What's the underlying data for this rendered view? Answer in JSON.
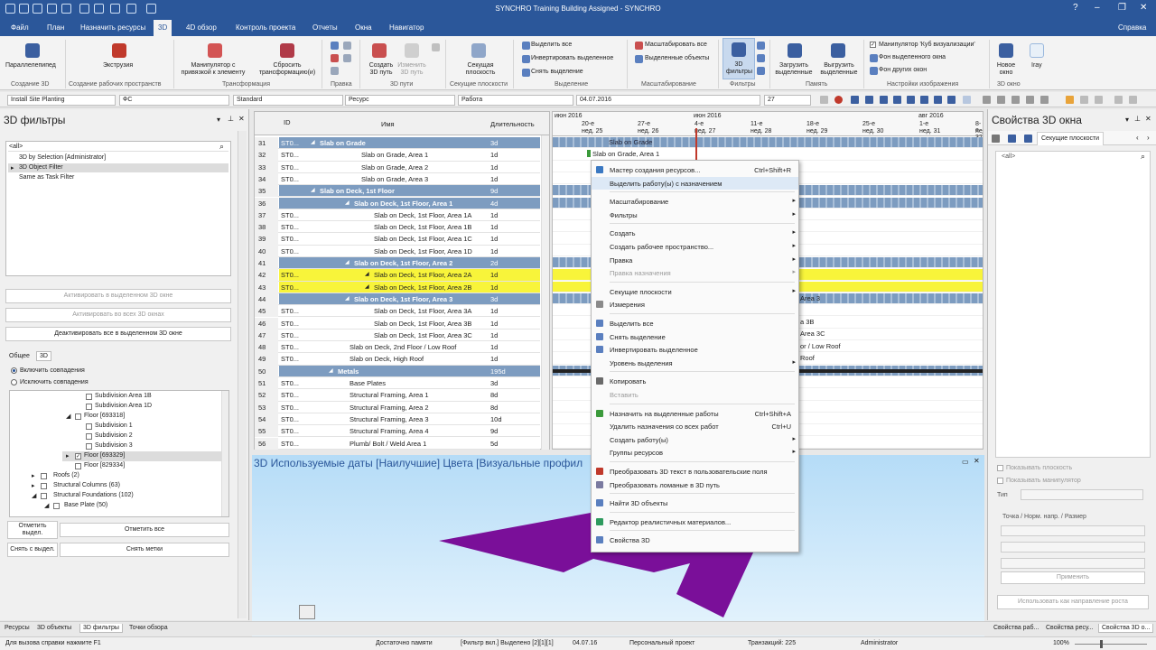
{
  "title": "SYNCHRO Training Building Assigned - SYNCHRO",
  "menu_tabs": [
    "Файл",
    "План",
    "Назначить ресурсы",
    "3D",
    "4D обзор",
    "Контроль проекта",
    "Отчеты",
    "Окна",
    "Навигатор"
  ],
  "help_label": "Справка",
  "ribbon": {
    "parallel": "Параллелепипед",
    "create3d": "Создание 3D",
    "extrude": "Экструзия",
    "create_ws": "Создание рабочих пространств",
    "manip": "Манипулятор с привязкой к элементу",
    "reset_tr": "Сбросить трансформацию(и)",
    "transform": "Трансформация",
    "edit": "Правка",
    "create3d_path": "Создать 3D путь",
    "change3d_path": "Изменить 3D путь",
    "paths3d": "3D пути",
    "section_plane": "Секущая плоскость",
    "section_planes": "Секущие плоскости",
    "sel_all": "Выделить все",
    "invert_sel": "Инвертировать выделенное",
    "clear_sel": "Снять выделение",
    "selection": "Выделение",
    "zoom_all": "Масштабировать все",
    "zoom_sel": "Выделенные объекты",
    "zoom": "Масштабирование",
    "filters3d": "3D фильтры",
    "filters": "Фильтры",
    "load_sel": "Загрузить выделенные",
    "unload_sel": "Выгрузить выделенные",
    "memory": "Память",
    "manip_cube": "Манипулятор 'Куб визуализации'",
    "bg_sel": "Фон выделенного окна",
    "bg_other": "Фон других окон",
    "image_settings": "Настройки изображения",
    "new_window": "Новое окно",
    "iray": "Iray",
    "window3d": "3D окно"
  },
  "filterbar": {
    "f1": "Install Site Planting",
    "f2": "ФС",
    "f3": "Standard",
    "f4": "Ресурс",
    "f5": "Работа",
    "date": "04.07.2016",
    "num": "27"
  },
  "left": {
    "title": "3D фильтры",
    "search_ph": "<all>",
    "items": [
      "3D by Selection [Administrator]",
      "3D Object Filter",
      "Same as Task Filter"
    ],
    "btn_act_sel": "Активировать в выделенном 3D окне",
    "btn_act_all": "Активировать во всех 3D окнах",
    "btn_deact": "Деактивировать все в выделенном 3D окне",
    "tab_common": "Общее",
    "tab_3d": "3D",
    "include": "Включить совпадения",
    "exclude": "Исключить совпадения",
    "tree": [
      "Subdivision Area 1B",
      "Subdivision Area 1D",
      "Floor [693318]",
      "Subdivision 1",
      "Subdivision 2",
      "Subdivision 3",
      "Floor [693329]",
      "Floor [829334]",
      "Roofs (2)",
      "Structural Columns (63)",
      "Structural Foundations (102)",
      "Base Plate (50)"
    ],
    "mark_sel": "Отметить выдел.",
    "mark_all": "Отметить все",
    "unmark_sel": "Снять с выдел.",
    "clear_marks": "Снять метки"
  },
  "grid": {
    "col_id": "ID",
    "col_name": "Имя",
    "col_dur": "Длительность",
    "rows": [
      {
        "n": "31",
        "id": "ST0...",
        "name": "Slab on Grade",
        "dur": "3d",
        "kind": "sum"
      },
      {
        "n": "32",
        "id": "ST0...",
        "name": "Slab on Grade, Area 1",
        "dur": "1d",
        "kind": "task"
      },
      {
        "n": "33",
        "id": "ST0...",
        "name": "Slab on Grade, Area 2",
        "dur": "1d",
        "kind": "task"
      },
      {
        "n": "34",
        "id": "ST0...",
        "name": "Slab on Grade, Area 3",
        "dur": "1d",
        "kind": "task"
      },
      {
        "n": "35",
        "id": "",
        "name": "Slab on Deck, 1st Floor",
        "dur": "9d",
        "kind": "sum"
      },
      {
        "n": "36",
        "id": "",
        "name": "Slab on Deck, 1st Floor, Area 1",
        "dur": "4d",
        "kind": "sum2"
      },
      {
        "n": "37",
        "id": "ST0...",
        "name": "Slab on Deck, 1st Floor, Area 1A",
        "dur": "1d",
        "kind": "task"
      },
      {
        "n": "38",
        "id": "ST0...",
        "name": "Slab on Deck, 1st Floor, Area 1B",
        "dur": "1d",
        "kind": "task"
      },
      {
        "n": "39",
        "id": "ST0...",
        "name": "Slab on Deck, 1st Floor, Area 1C",
        "dur": "1d",
        "kind": "task"
      },
      {
        "n": "40",
        "id": "ST0...",
        "name": "Slab on Deck, 1st Floor, Area 1D",
        "dur": "1d",
        "kind": "task"
      },
      {
        "n": "41",
        "id": "",
        "name": "Slab on Deck, 1st Floor, Area 2",
        "dur": "2d",
        "kind": "sum2"
      },
      {
        "n": "42",
        "id": "ST0...",
        "name": "Slab on Deck, 1st Floor, Area 2A",
        "dur": "1d",
        "kind": "yel"
      },
      {
        "n": "43",
        "id": "ST0...",
        "name": "Slab on Deck, 1st Floor, Area 2B",
        "dur": "1d",
        "kind": "yel"
      },
      {
        "n": "44",
        "id": "",
        "name": "Slab on Deck, 1st Floor, Area 3",
        "dur": "3d",
        "kind": "sum2"
      },
      {
        "n": "45",
        "id": "ST0...",
        "name": "Slab on Deck, 1st Floor, Area 3A",
        "dur": "1d",
        "kind": "task"
      },
      {
        "n": "46",
        "id": "ST0...",
        "name": "Slab on Deck, 1st Floor, Area 3B",
        "dur": "1d",
        "kind": "task"
      },
      {
        "n": "47",
        "id": "ST0...",
        "name": "Slab on Deck, 1st Floor, Area 3C",
        "dur": "1d",
        "kind": "task"
      },
      {
        "n": "48",
        "id": "ST0...",
        "name": "Slab on Deck, 2nd Floor / Low Roof",
        "dur": "1d",
        "kind": "task"
      },
      {
        "n": "49",
        "id": "ST0...",
        "name": "Slab on Deck, High Roof",
        "dur": "1d",
        "kind": "task"
      },
      {
        "n": "50",
        "id": "",
        "name": "Metals",
        "dur": "195d",
        "kind": "sum"
      },
      {
        "n": "51",
        "id": "ST0...",
        "name": "Base Plates",
        "dur": "3d",
        "kind": "task"
      },
      {
        "n": "52",
        "id": "ST0...",
        "name": "Structural Framing, Area 1",
        "dur": "8d",
        "kind": "task"
      },
      {
        "n": "53",
        "id": "ST0...",
        "name": "Structural Framing, Area 2",
        "dur": "8d",
        "kind": "task"
      },
      {
        "n": "54",
        "id": "ST0...",
        "name": "Structural Framing, Area 3",
        "dur": "10d",
        "kind": "task"
      },
      {
        "n": "55",
        "id": "ST0...",
        "name": "Structural Framing, Area 4",
        "dur": "9d",
        "kind": "task"
      },
      {
        "n": "56",
        "id": "ST0...",
        "name": "Plumb/ Bolt / Weld Area 1",
        "dur": "5d",
        "kind": "task"
      }
    ]
  },
  "gantt": {
    "months": [
      "июн 2016",
      "июн 2016",
      "авг 2016"
    ],
    "days": [
      "20-е",
      "27-е",
      "4-е",
      "11-е",
      "18-е",
      "25-е",
      "1-е",
      "8-е"
    ],
    "weeks": [
      "нед. 25",
      "нед. 26",
      "нед. 27",
      "нед. 28",
      "нед. 29",
      "нед. 30",
      "нед. 31",
      "нед. 32"
    ],
    "labels": [
      "Slab on Grade",
      "Slab on Grade, Area 1",
      "Area 3",
      "a 3B",
      "Area 3C",
      "or / Low Roof",
      "Roof"
    ]
  },
  "viewer": {
    "title": "3D Используемые даты [Наилучшие] Цвета [Визуальные профил"
  },
  "context_menu": [
    {
      "t": "Мастер создания ресурсов...",
      "k": "Ctrl+Shift+R",
      "ico": "#3a78c2"
    },
    {
      "t": "Выделить работу(ы) с назначением",
      "hl": true
    },
    {
      "sep": true
    },
    {
      "t": "Масштабирование",
      "sub": true
    },
    {
      "t": "Фильтры",
      "sub": true
    },
    {
      "sep": true
    },
    {
      "t": "Создать",
      "sub": true
    },
    {
      "t": "Создать рабочее пространство...",
      "sub": true
    },
    {
      "t": "Правка",
      "sub": true
    },
    {
      "t": "Правка назначения",
      "sub": true,
      "dis": true
    },
    {
      "sep": true
    },
    {
      "t": "Секущие плоскости",
      "sub": true
    },
    {
      "t": "Измерения",
      "ico": "#8a8a8a"
    },
    {
      "sep": true
    },
    {
      "t": "Выделить все",
      "ico": "#5a7fbf"
    },
    {
      "t": "Снять выделение",
      "ico": "#5a7fbf"
    },
    {
      "t": "Инвертировать выделенное",
      "ico": "#5a7fbf"
    },
    {
      "t": "Уровень выделения",
      "sub": true
    },
    {
      "sep": true
    },
    {
      "t": "Копировать",
      "ico": "#6a6a6a"
    },
    {
      "t": "Вставить",
      "dis": true
    },
    {
      "sep": true
    },
    {
      "t": "Назначить на выделенные работы",
      "k": "Ctrl+Shift+A",
      "ico": "#3b9a3b"
    },
    {
      "t": "Удалить назначения со всех работ",
      "k": "Ctrl+U"
    },
    {
      "t": "Создать работу(ы)",
      "sub": true
    },
    {
      "t": "Группы ресурсов",
      "sub": true
    },
    {
      "sep": true
    },
    {
      "t": "Преобразовать 3D текст в пользовательские поля",
      "ico": "#c0392b"
    },
    {
      "t": "Преобразовать ломаные в 3D путь",
      "ico": "#7a7aa0"
    },
    {
      "sep": true
    },
    {
      "t": "Найти 3D объекты",
      "ico": "#5a7fbf"
    },
    {
      "sep": true
    },
    {
      "t": "Редактор реалистичных материалов...",
      "ico": "#2e9a5e"
    },
    {
      "sep": true
    },
    {
      "t": "Свойства 3D",
      "ico": "#5a7fbf"
    }
  ],
  "right": {
    "title": "Свойства 3D окна",
    "tab": "Секущие плоскости",
    "search_ph": "<all>",
    "show_plane": "Показывать плоскость",
    "show_manip": "Показывать манипулятор",
    "type_label": "Тип",
    "point_label": "Точка / Норм. напр. / Размер",
    "apply": "Применить",
    "use_dir": "Использовать как направление роста"
  },
  "bottom_tabs": [
    "Ресурсы",
    "3D объекты",
    "3D фильтры",
    "Точки обзора"
  ],
  "bottom_tabs_right": [
    "Свойства раб...",
    "Свойства ресу...",
    "Свойства 3D о..."
  ],
  "status": {
    "help": "Для вызова справки нажмите F1",
    "memory": "Достаточно памяти",
    "filter": "[Фильтр вкл.] Выделено [2][1][1]",
    "date": "04.07.16",
    "project": "Персональный проект",
    "tx": "Транзакций: 225",
    "user": "Administrator",
    "zoom": "100%"
  }
}
